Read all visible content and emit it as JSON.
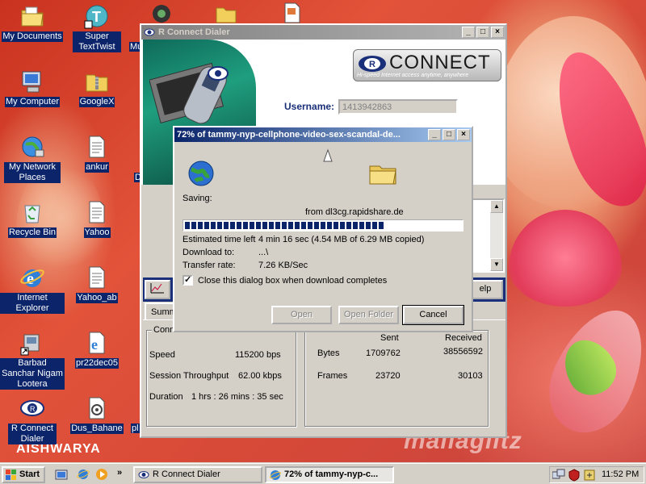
{
  "desktop": {
    "icons": [
      {
        "label": "My Documents"
      },
      {
        "label": "My Computer"
      },
      {
        "label": "My Network Places"
      },
      {
        "label": "Recycle Bin"
      },
      {
        "label": "Internet Explorer"
      },
      {
        "label": "Barbad Sanchar Nigam Lootera"
      },
      {
        "label": "R Connect Dialer"
      },
      {
        "label": "Super TextTwist"
      },
      {
        "label": "GoogleX"
      },
      {
        "label": "ankur"
      },
      {
        "label": "Yahoo"
      },
      {
        "label": "Yahoo_ab"
      },
      {
        "label": "pr22dec05"
      },
      {
        "label": "Dus_Bahane"
      }
    ],
    "partial_labels": {
      "mu": "Mu",
      "d": "D",
      "pl": "pl"
    },
    "wallpaper_text": {
      "left": "AISHWARYA",
      "right": "mallaglitz"
    }
  },
  "dialer": {
    "title": "R Connect Dialer",
    "brand": {
      "name": "CONNECT",
      "letter": "R",
      "tagline": "Hi-speed Internet access anytime, anywhere"
    },
    "username_label": "Username:",
    "username_value": "1413942863",
    "help_label": "elp",
    "summary_tab": "Summ",
    "connection_group": "Conn",
    "stats": {
      "speed_label": "Speed",
      "speed_value": "115200 bps",
      "throughput_label": "Session Throughput",
      "throughput_value": "62.00 kbps",
      "duration_label": "Duration",
      "duration_value": "1 hrs : 26 mins : 35 sec"
    },
    "traffic": {
      "sent_header": "Sent",
      "received_header": "Received",
      "bytes_label": "Bytes",
      "bytes_sent": "1709762",
      "bytes_received": "38556592",
      "frames_label": "Frames",
      "frames_sent": "23720",
      "frames_received": "30103"
    }
  },
  "download": {
    "title": "72% of tammy-nyp-cellphone-video-sex-scandal-de...",
    "saving_label": "Saving:",
    "from_text": "from dl3cg.rapidshare.de",
    "progress": 0.72,
    "estimated_label": "Estimated time left",
    "estimated_value": "4 min 16 sec (4.54 MB of 6.29 MB copied)",
    "download_to_label": "Download to:",
    "download_to_value": "...\\",
    "rate_label": "Transfer rate:",
    "rate_value": "7.26 KB/Sec",
    "close_checkbox_label": "Close this dialog box when download completes",
    "close_checked": true,
    "open_button": "Open",
    "open_folder_button": "Open Folder",
    "cancel_button": "Cancel"
  },
  "taskbar": {
    "start_label": "Start",
    "tasks": [
      {
        "label": "R Connect Dialer"
      },
      {
        "label": "72% of tammy-nyp-c..."
      }
    ],
    "chevron": "»",
    "clock": "11:52 PM"
  }
}
